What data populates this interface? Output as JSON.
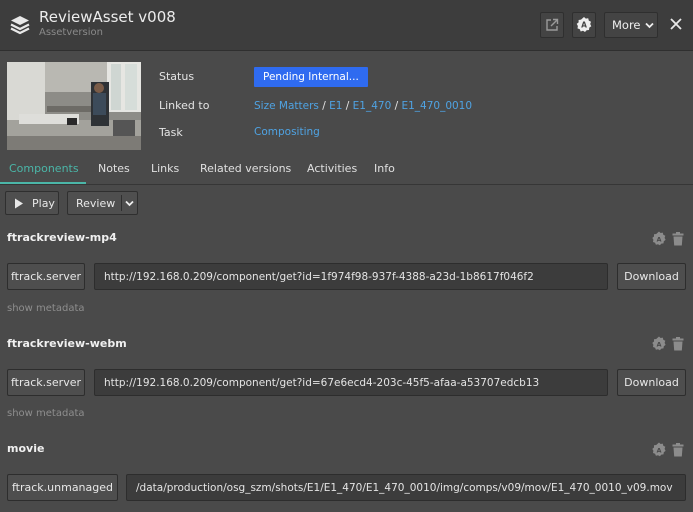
{
  "header": {
    "title": "ReviewAsset v008",
    "subtitle": "Assetversion",
    "more_label": "More"
  },
  "details": {
    "status_label": "Status",
    "status_value": "Pending Internal...",
    "linked_label": "Linked to",
    "linked_path": [
      "Size Matters",
      "E1",
      "E1_470",
      "E1_470_0010"
    ],
    "separator": " / ",
    "task_label": "Task",
    "task_value": "Compositing"
  },
  "tabs": [
    {
      "label": "Components",
      "active": true
    },
    {
      "label": "Notes",
      "active": false
    },
    {
      "label": "Links",
      "active": false
    },
    {
      "label": "Related versions",
      "active": false
    },
    {
      "label": "Activities",
      "active": false
    },
    {
      "label": "Info",
      "active": false
    }
  ],
  "toolbar": {
    "play_label": "Play",
    "review_label": "Review"
  },
  "components": [
    {
      "name": "ftrackreview-mp4",
      "location": "ftrack.server",
      "url": "http://192.168.0.209/component/get?id=1f974f98-937f-4388-a23d-1b8617f046f2",
      "download_label": "Download",
      "metadata_label": "show metadata"
    },
    {
      "name": "ftrackreview-webm",
      "location": "ftrack.server",
      "url": "http://192.168.0.209/component/get?id=67e6ecd4-203c-45f5-afaa-a53707edcb13",
      "download_label": "Download",
      "metadata_label": "show metadata"
    },
    {
      "name": "movie",
      "location": "ftrack.unmanaged",
      "url": "/data/production/osg_szm/shots/E1/E1_470/E1_470_0010/img/comps/v09/mov/E1_470_0010_v09.mov"
    }
  ],
  "colors": {
    "accent": "#4bb6a8",
    "status": "#2f6bf0",
    "link": "#4fa3e3",
    "background": "#4a4a4a"
  },
  "icons": {
    "logo": "layers-icon",
    "open": "external-link-icon",
    "settings": "settings-badge-icon",
    "close": "close-icon",
    "play": "play-icon",
    "chevron": "chevron-down-icon",
    "component_settings": "gear-icon",
    "delete": "trash-icon"
  }
}
